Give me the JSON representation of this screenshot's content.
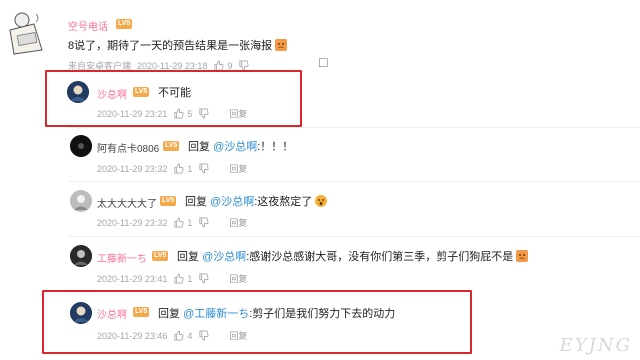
{
  "comments": [
    {
      "name": "空号电话",
      "level": "LV5",
      "text": "8说了，期待了一天的预告结果是一张海报",
      "meta_time": "2020-11-29 23:18",
      "meta_source": "来自安卓客户端",
      "likes": "9",
      "reply_label": ""
    },
    {
      "name": "沙总啊",
      "level": "LV5",
      "text": "不可能",
      "meta_time": "2020-11-29 23:21",
      "likes": "5",
      "reply_label": "回复"
    },
    {
      "name": "阿有点卡0806",
      "level": "LV5",
      "reply_prefix": "回复",
      "mention": "@沙总啊",
      "text": ":！！！",
      "meta_time": "2020-11-29 23:32",
      "likes": "1",
      "reply_label": "回复"
    },
    {
      "name": "太大大大大了",
      "level": "LV5",
      "reply_prefix": "回复",
      "mention": "@沙总啊",
      "text": ":这夜熬定了",
      "meta_time": "2020-11-29 23:32",
      "likes": "1",
      "reply_label": "回复"
    },
    {
      "name": "工藤新一ち",
      "level": "LV5",
      "reply_prefix": "回复",
      "mention": "@沙总啊",
      "text": ":感谢沙总感谢大哥，没有你们第三季，剪子们狗屁不是",
      "meta_time": "2020-11-29 23:41",
      "likes": "1",
      "reply_label": "回复"
    },
    {
      "name": "沙总啊",
      "level": "LV5",
      "reply_prefix": "回复",
      "mention": "@工藤新一ち",
      "text": ":剪子们是我们努力下去的动力",
      "meta_time": "2020-11-29 23:46",
      "likes": "4",
      "reply_label": "回复"
    }
  ],
  "watermark": "EYJNG",
  "colors": {
    "highlight": "#d9272d",
    "username": "#fb7299",
    "mention": "#2c8ed3",
    "level_badge": "#f6a94a"
  }
}
